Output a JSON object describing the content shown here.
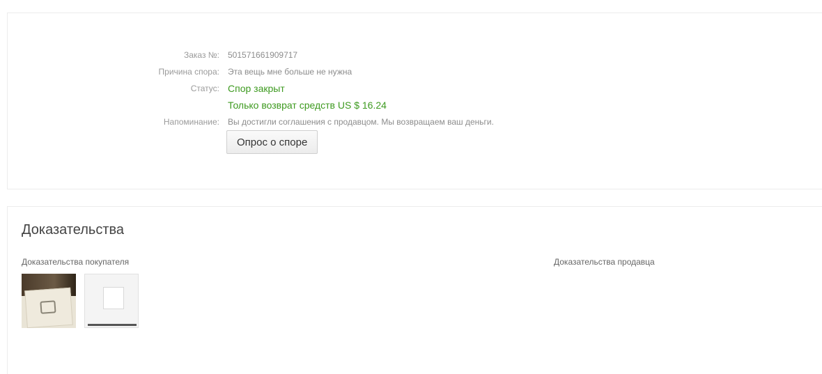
{
  "dispute": {
    "order_label": "Заказ №:",
    "order_value": "501571661909717",
    "reason_label": "Причина спора:",
    "reason_value": "Эта вещь мне больше не нужна",
    "status_label": "Статус:",
    "status_value": "Спор закрыт",
    "refund_value": "Только возврат средств US $ 16.24",
    "notice_label": "Напоминание:",
    "notice_value": "Вы достигли соглашения с продавцом. Мы возвращаем ваш деньги.",
    "survey_button": "Опрос о споре"
  },
  "evidence": {
    "title": "Доказательства",
    "buyer_label": "Доказательства покупателя",
    "seller_label": "Доказательства продавца"
  },
  "colors": {
    "status_green": "#3d9a1f",
    "label_gray": "#9a9a9a"
  }
}
